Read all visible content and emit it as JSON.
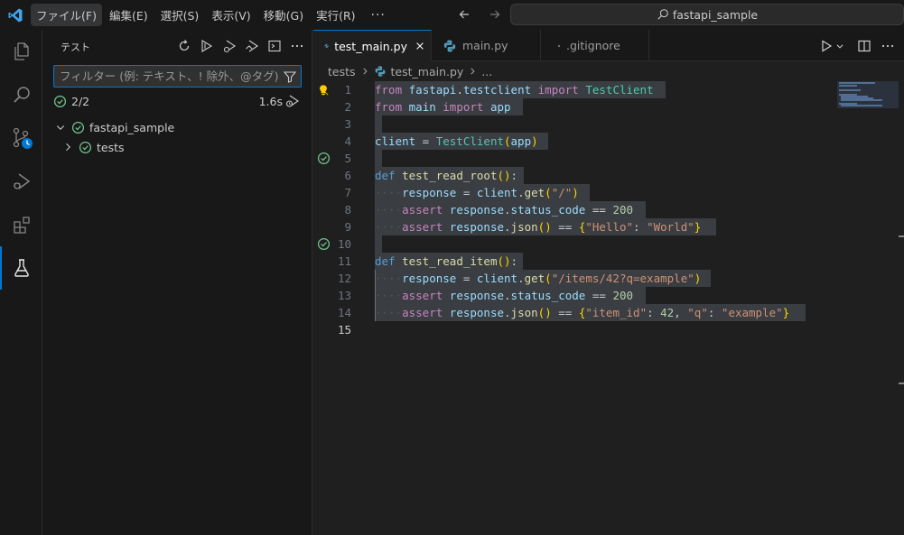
{
  "title_bar": {
    "menu": [
      {
        "label": "ファイル(F)",
        "active": true
      },
      {
        "label": "編集(E)"
      },
      {
        "label": "選択(S)"
      },
      {
        "label": "表示(V)"
      },
      {
        "label": "移動(G)"
      },
      {
        "label": "実行(R)"
      }
    ],
    "more": "···",
    "search_text": "fastapi_sample"
  },
  "activity_bar": {
    "items": [
      {
        "icon": "explorer-icon"
      },
      {
        "icon": "search-icon"
      },
      {
        "icon": "source-control-icon"
      },
      {
        "icon": "run-debug-icon"
      },
      {
        "icon": "extensions-icon"
      },
      {
        "icon": "testing-icon",
        "active": true
      }
    ]
  },
  "sidebar": {
    "title": "テスト",
    "actions": [
      "refresh-icon",
      "run-tests-icon",
      "debug-tests-icon",
      "run-coverage-icon",
      "terminal-icon",
      "more-icon"
    ],
    "filter_placeholder": "フィルター (例: テキスト、! 除外、@タグ)",
    "summary": {
      "count": "2/2",
      "duration": "1.6s"
    },
    "tree": [
      {
        "label": "fastapi_sample",
        "expanded": true,
        "status": "passed"
      },
      {
        "label": "tests",
        "expanded": false,
        "status": "passed"
      }
    ]
  },
  "tabs": [
    {
      "label": "test_main.py",
      "active": true,
      "icon": "python-icon"
    },
    {
      "label": "main.py",
      "active": false,
      "icon": "python-icon"
    },
    {
      "label": ".gitignore",
      "active": false,
      "icon": "gitignore-icon"
    }
  ],
  "breadcrumb": [
    "tests",
    "test_main.py",
    "..."
  ],
  "editor": {
    "line_numbers": [
      "1",
      "2",
      "3",
      "4",
      "5",
      "6",
      "7",
      "8",
      "9",
      "10",
      "11",
      "12",
      "13",
      "14",
      "15"
    ],
    "current_line": "15",
    "lines": [
      "from fastapi.testclient import TestClient",
      "from main import app",
      "",
      "client = TestClient(app)",
      "",
      "def test_read_root():",
      "    response = client.get(\"/\")",
      "    assert response.status_code == 200",
      "    assert response.json() == {\"Hello\": \"World\"}",
      "",
      "def test_read_item():",
      "    response = client.get(\"/items/42?q=example\")",
      "    assert response.status_code == 200",
      "    assert response.json() == {\"item_id\": 42, \"q\": \"example\"}",
      ""
    ]
  },
  "colors": {
    "accent": "#0078d4",
    "passed": "#73c991",
    "lightbulb": "#ffcc00"
  }
}
